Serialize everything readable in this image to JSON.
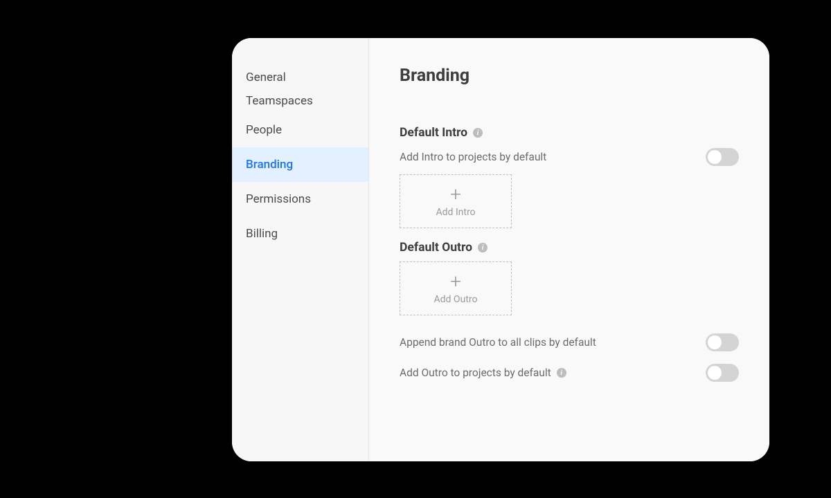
{
  "sidebar": {
    "items": [
      {
        "label": "General",
        "active": false
      },
      {
        "label": "Teamspaces",
        "active": false
      },
      {
        "label": "People",
        "active": false
      },
      {
        "label": "Branding",
        "active": true
      },
      {
        "label": "Permissions",
        "active": false
      },
      {
        "label": "Billing",
        "active": false
      }
    ]
  },
  "page": {
    "title": "Branding"
  },
  "sections": {
    "intro": {
      "title": "Default Intro",
      "toggle_label": "Add Intro to projects by default",
      "dropzone_label": "Add Intro"
    },
    "outro": {
      "title": "Default Outro",
      "dropzone_label": "Add Outro",
      "append_label": "Append brand Outro to all clips by default",
      "add_label": "Add Outro to projects by default"
    }
  },
  "icons": {
    "info_glyph": "i",
    "plus_glyph": "+"
  }
}
